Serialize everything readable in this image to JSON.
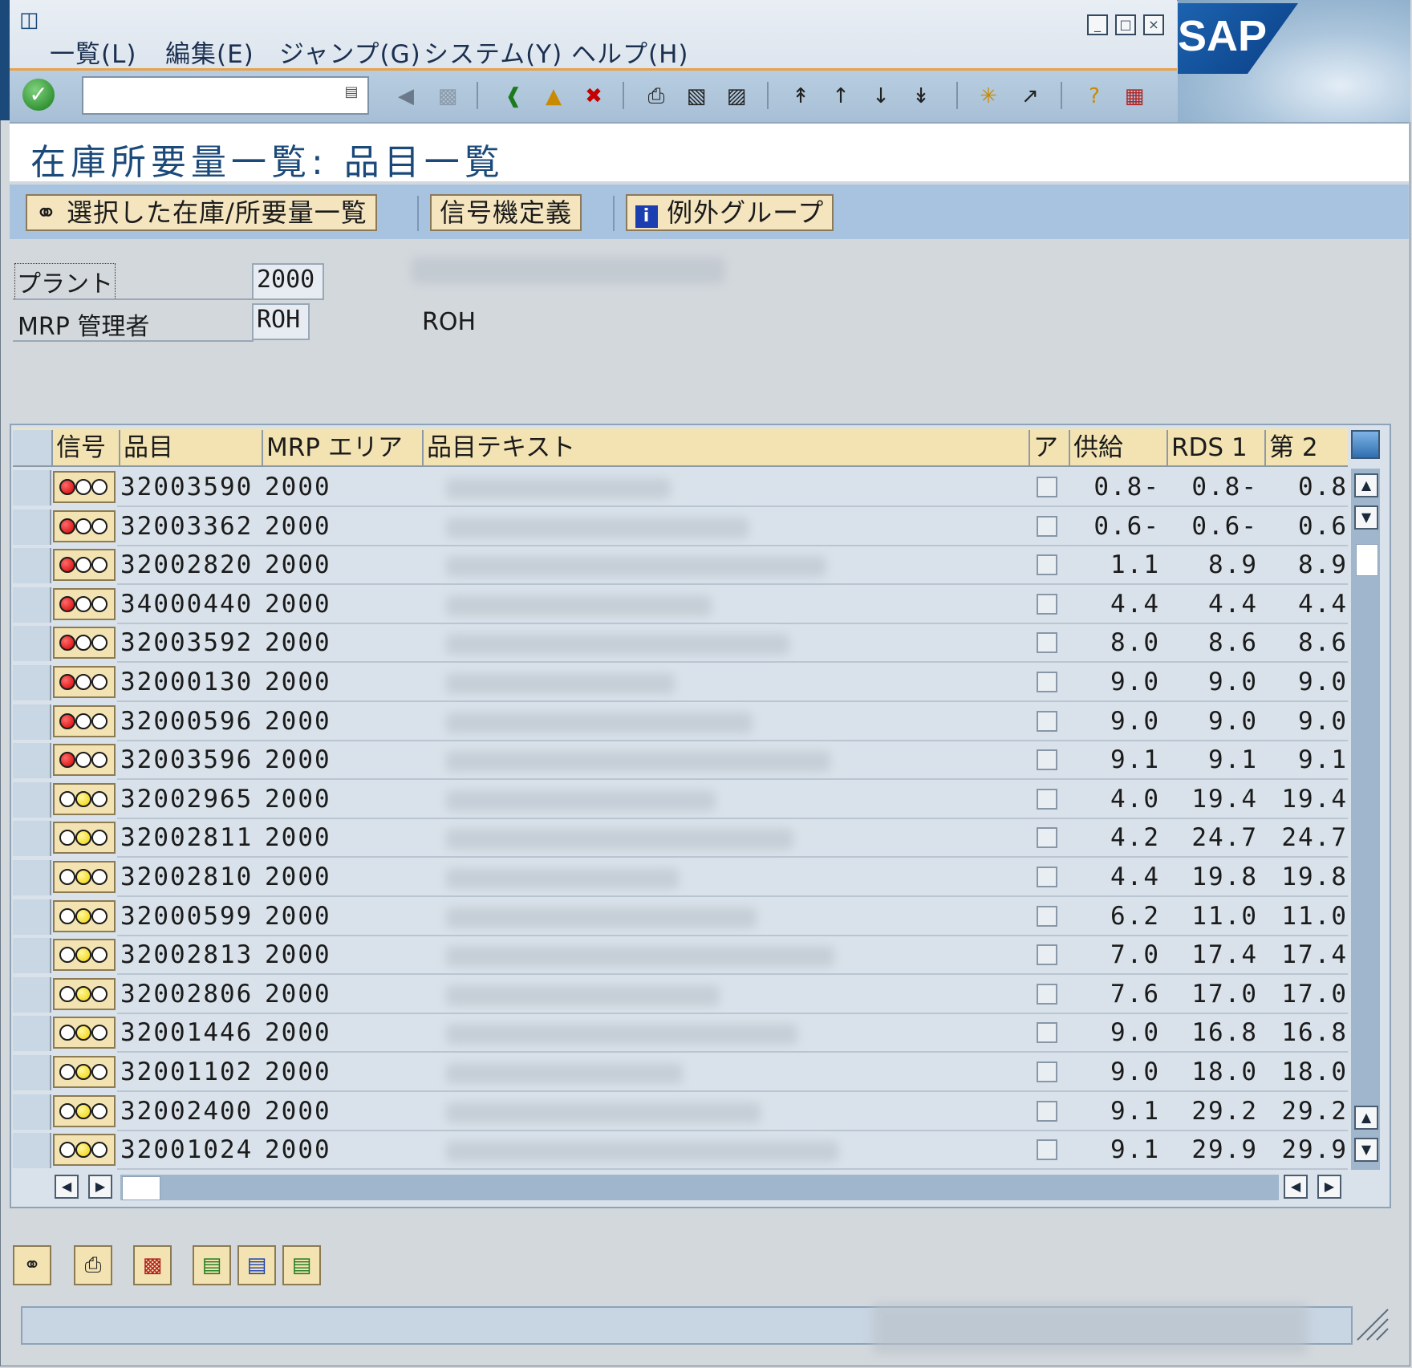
{
  "menu": {
    "items": [
      "一覧(L)",
      "編集(E)",
      "ジャンプ(G)",
      "システム(Y)",
      "ヘルプ(H)"
    ]
  },
  "toolbar": {
    "command_value": "",
    "icons": [
      "enter-icon",
      "back-arrow-icon",
      "save-icon",
      "back-icon",
      "exit-icon",
      "cancel-icon",
      "print-icon",
      "find-icon",
      "find-next-icon",
      "first-page-icon",
      "previous-page-icon",
      "next-page-icon",
      "last-page-icon",
      "new-session-icon",
      "shortcut-icon",
      "help-icon",
      "layout-icon"
    ]
  },
  "brand": {
    "logo_text": "SAP",
    "accent": "#e8a24a",
    "nav": "#1b4a7a"
  },
  "title": "在庫所要量一覧: 品目一覧",
  "app_toolbar": {
    "btn_selected": "選択した在庫/所要量一覧",
    "btn_signal": "信号機定義",
    "btn_exception": "例外グループ"
  },
  "header": {
    "plant_label": "プラント",
    "plant_value": "2000",
    "mrp_label": "MRP 管理者",
    "mrp_value": "ROH",
    "mrp_desc": "ROH"
  },
  "table": {
    "columns": {
      "signal": "信号",
      "material": "品目",
      "mrp_area": "MRP エリア",
      "text": "品目テキスト",
      "a": "ア",
      "supply": "供給",
      "rds1": "RDS 1",
      "second": "第 2"
    },
    "rows": [
      {
        "signal": "red",
        "material": "32003590",
        "area": "2000",
        "supply": "0.8-",
        "rds1": "0.8-",
        "second": "0.8"
      },
      {
        "signal": "red",
        "material": "32003362",
        "area": "2000",
        "supply": "0.6-",
        "rds1": "0.6-",
        "second": "0.6"
      },
      {
        "signal": "red",
        "material": "32002820",
        "area": "2000",
        "supply": "1.1",
        "rds1": "8.9",
        "second": "8.9"
      },
      {
        "signal": "red",
        "material": "34000440",
        "area": "2000",
        "supply": "4.4",
        "rds1": "4.4",
        "second": "4.4"
      },
      {
        "signal": "red",
        "material": "32003592",
        "area": "2000",
        "supply": "8.0",
        "rds1": "8.6",
        "second": "8.6"
      },
      {
        "signal": "red",
        "material": "32000130",
        "area": "2000",
        "supply": "9.0",
        "rds1": "9.0",
        "second": "9.0"
      },
      {
        "signal": "red",
        "material": "32000596",
        "area": "2000",
        "supply": "9.0",
        "rds1": "9.0",
        "second": "9.0"
      },
      {
        "signal": "red",
        "material": "32003596",
        "area": "2000",
        "supply": "9.1",
        "rds1": "9.1",
        "second": "9.1"
      },
      {
        "signal": "yellow",
        "material": "32002965",
        "area": "2000",
        "supply": "4.0",
        "rds1": "19.4",
        "second": "19.4"
      },
      {
        "signal": "yellow",
        "material": "32002811",
        "area": "2000",
        "supply": "4.2",
        "rds1": "24.7",
        "second": "24.7"
      },
      {
        "signal": "yellow",
        "material": "32002810",
        "area": "2000",
        "supply": "4.4",
        "rds1": "19.8",
        "second": "19.8"
      },
      {
        "signal": "yellow",
        "material": "32000599",
        "area": "2000",
        "supply": "6.2",
        "rds1": "11.0",
        "second": "11.0"
      },
      {
        "signal": "yellow",
        "material": "32002813",
        "area": "2000",
        "supply": "7.0",
        "rds1": "17.4",
        "second": "17.4"
      },
      {
        "signal": "yellow",
        "material": "32002806",
        "area": "2000",
        "supply": "7.6",
        "rds1": "17.0",
        "second": "17.0"
      },
      {
        "signal": "yellow",
        "material": "32001446",
        "area": "2000",
        "supply": "9.0",
        "rds1": "16.8",
        "second": "16.8"
      },
      {
        "signal": "yellow",
        "material": "32001102",
        "area": "2000",
        "supply": "9.0",
        "rds1": "18.0",
        "second": "18.0"
      },
      {
        "signal": "yellow",
        "material": "32002400",
        "area": "2000",
        "supply": "9.1",
        "rds1": "29.2",
        "second": "29.2"
      },
      {
        "signal": "yellow",
        "material": "32001024",
        "area": "2000",
        "supply": "9.1",
        "rds1": "29.9",
        "second": "29.9"
      }
    ]
  },
  "bottom_icons": [
    "signal-icon",
    "print-icon",
    "chart-icon",
    "export-icon",
    "export2-icon",
    "export3-icon"
  ],
  "status": {
    "text": ""
  }
}
